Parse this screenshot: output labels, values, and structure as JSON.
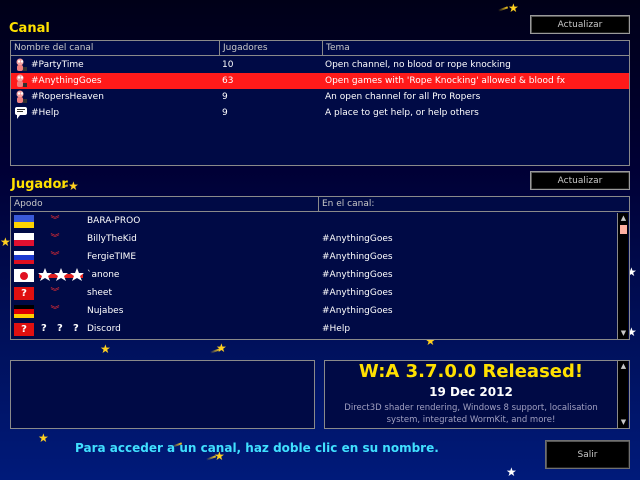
{
  "channels": {
    "title": "Canal",
    "refresh_label": "Actualizar",
    "columns": [
      "Nombre del canal",
      "Jugadores",
      "Tema"
    ],
    "rows": [
      {
        "icon": "worm-icon",
        "name": "#PartyTime",
        "players": "10",
        "topic": "Open channel, no blood or rope knocking",
        "selected": false
      },
      {
        "icon": "worm-icon",
        "name": "#AnythingGoes",
        "players": "63",
        "topic": "Open games with 'Rope Knocking' allowed & blood fx",
        "selected": true
      },
      {
        "icon": "worm-icon",
        "name": "#RopersHeaven",
        "players": "9",
        "topic": "An open channel for all Pro Ropers",
        "selected": false
      },
      {
        "icon": "speech-bubble-icon",
        "name": "#Help",
        "players": "9",
        "topic": "A place to get help, or help others",
        "selected": false
      }
    ]
  },
  "players": {
    "title": "Jugador",
    "refresh_label": "Actualizar",
    "columns": [
      "Apodo",
      "En el canal:"
    ],
    "rows": [
      {
        "flag": "ukraine",
        "rank": "chevron",
        "nick": "BARA-PROO",
        "channel": ""
      },
      {
        "flag": "poland",
        "rank": "chevron",
        "nick": "BillyTheKid",
        "channel": "#AnythingGoes"
      },
      {
        "flag": "russia",
        "rank": "chevron",
        "nick": "FergieTIME",
        "channel": "#AnythingGoes"
      },
      {
        "flag": "japan",
        "rank": "stars",
        "nick": "`anone",
        "channel": "#AnythingGoes"
      },
      {
        "flag": "unknown",
        "rank": "chevron",
        "nick": "sheet",
        "channel": "#AnythingGoes"
      },
      {
        "flag": "germany",
        "rank": "chevron",
        "nick": "Nujabes",
        "channel": "#AnythingGoes"
      },
      {
        "flag": "unknown",
        "rank": "unknown",
        "nick": "Discord",
        "channel": "#Help"
      }
    ]
  },
  "news": {
    "title": "W:A 3.7.0.0 Released!",
    "date": "19 Dec 2012",
    "body_line1": "Direct3D shader rendering, Windows 8 support, localisation",
    "body_line2": "system, integrated WormKit, and more!"
  },
  "hint": "Para acceder a un canal, haz doble clic en su nombre.",
  "exit_label": "Salir",
  "unknown_mark": "?",
  "colors": {
    "title": "#ffe000",
    "selected_row": "#ff1a1a",
    "hint": "#40e0ff"
  }
}
